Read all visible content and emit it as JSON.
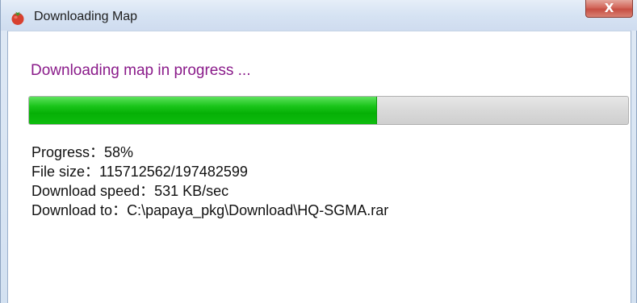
{
  "window": {
    "title": "Downloading Map",
    "close_label": "X"
  },
  "dialog": {
    "heading": "Downloading map in progress ...",
    "progress_percent": 58,
    "lines": {
      "progress": "Progress：58%",
      "file_size": "File size：115712562/197482599",
      "download_speed": "Download speed：531 KB/sec",
      "download_to": "Download to：C:\\papaya_pkg\\Download\\HQ-SGMA.rar"
    }
  },
  "colors": {
    "heading": "#8a1b8a",
    "progress_fill": "#06b006",
    "progress_track": "#d9d9d9",
    "close_button": "#c74f43"
  },
  "icons": {
    "app": "tomato-icon",
    "close": "close-icon"
  }
}
